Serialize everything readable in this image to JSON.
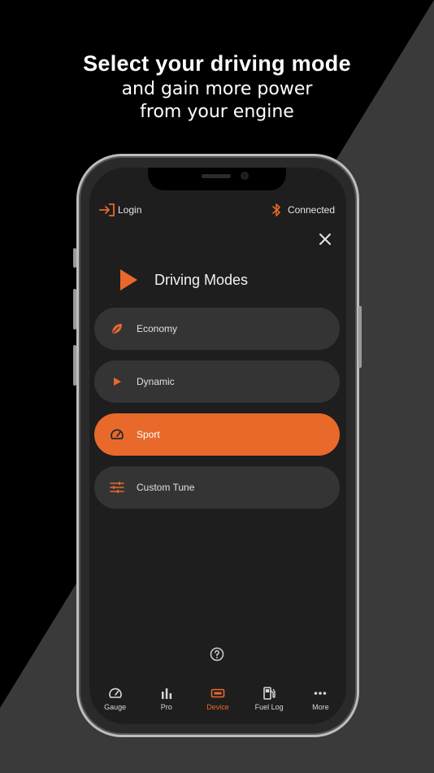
{
  "headline": {
    "line1": "Select your driving mode",
    "line2": "and gain more power",
    "line3": "from your engine"
  },
  "topbar": {
    "login_label": "Login",
    "status_label": "Connected"
  },
  "panel": {
    "title": "Driving Modes"
  },
  "modes": [
    {
      "label": "Economy",
      "icon": "leaf-icon",
      "active": false
    },
    {
      "label": "Dynamic",
      "icon": "play-icon",
      "active": false
    },
    {
      "label": "Sport",
      "icon": "speedometer-icon",
      "active": true
    },
    {
      "label": "Custom Tune",
      "icon": "sliders-icon",
      "active": false
    }
  ],
  "tabs": [
    {
      "label": "Gauge",
      "icon": "gauge-icon"
    },
    {
      "label": "Pro",
      "icon": "bar-chart-icon"
    },
    {
      "label": "Device",
      "icon": "device-icon"
    },
    {
      "label": "Fuel Log",
      "icon": "fuel-pump-icon"
    },
    {
      "label": "More",
      "icon": "more-dots-icon"
    }
  ],
  "colors": {
    "accent": "#e8692a",
    "background": "#000000",
    "screen": "#1e1e1e",
    "mode_pill": "#343434"
  }
}
